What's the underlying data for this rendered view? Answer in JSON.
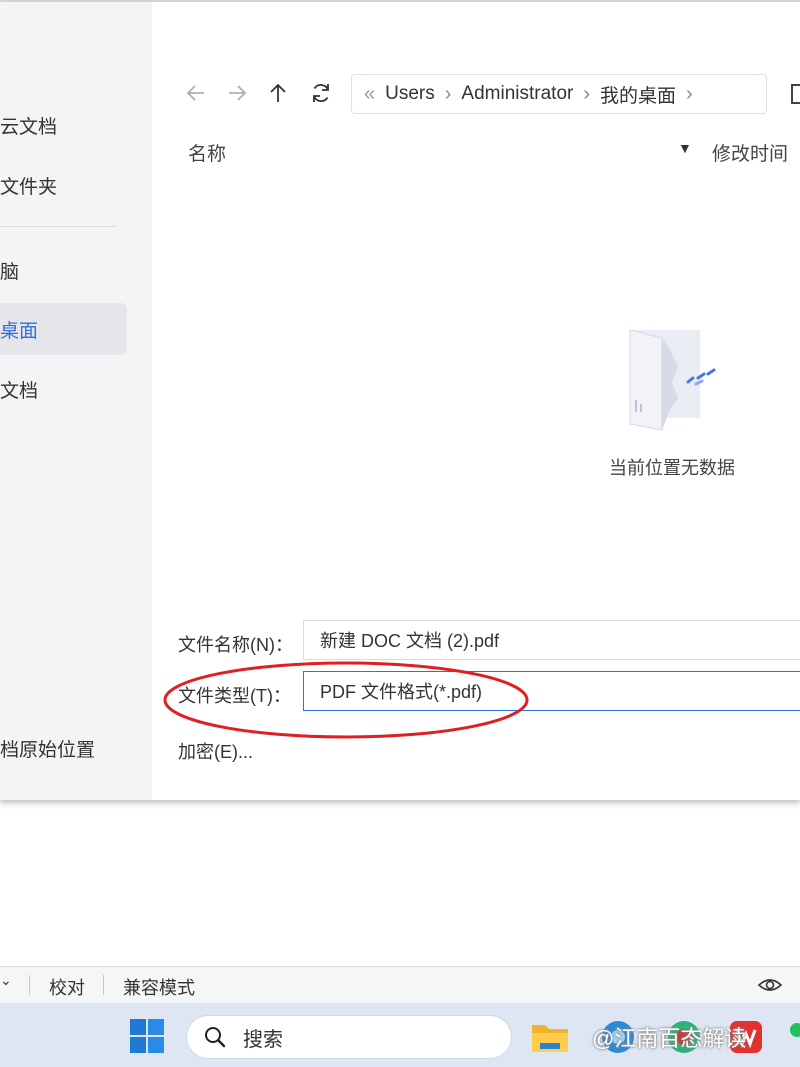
{
  "sidebar": {
    "items": [
      {
        "label": "云文档",
        "active": false
      },
      {
        "label": "文件夹",
        "active": false
      },
      {
        "label": "脑",
        "active": false
      },
      {
        "label": "桌面",
        "active": true
      },
      {
        "label": "文档",
        "active": false
      },
      {
        "label": "档原始位置",
        "active": false
      }
    ]
  },
  "nav": {
    "back_icon": "arrow-left-icon",
    "forward_icon": "arrow-right-icon",
    "up_icon": "arrow-up-icon",
    "refresh_icon": "refresh-icon"
  },
  "breadcrumb": {
    "overflow": "«",
    "items": [
      "Users",
      "Administrator",
      "我的桌面"
    ]
  },
  "columns": {
    "name": "名称",
    "modified": "修改时间"
  },
  "empty_state": {
    "message": "当前位置无数据"
  },
  "form": {
    "filename_label": "文件名称(N)：",
    "filename_value": "新建 DOC 文档 (2).pdf",
    "filetype_label": "文件类型(T)：",
    "filetype_value": "PDF 文件格式(*.pdf)",
    "encrypt_label": "加密(E)..."
  },
  "statusbar": {
    "proofread": "校对",
    "compat_mode": "兼容模式"
  },
  "taskbar": {
    "search_placeholder": "搜索",
    "watermark": "@江南百态解读"
  },
  "colors": {
    "accent": "#2f6fe0",
    "annotation": "#e02020",
    "sidebar_bg": "#f3f4f6",
    "taskbar_bg": "#dde6f2"
  }
}
